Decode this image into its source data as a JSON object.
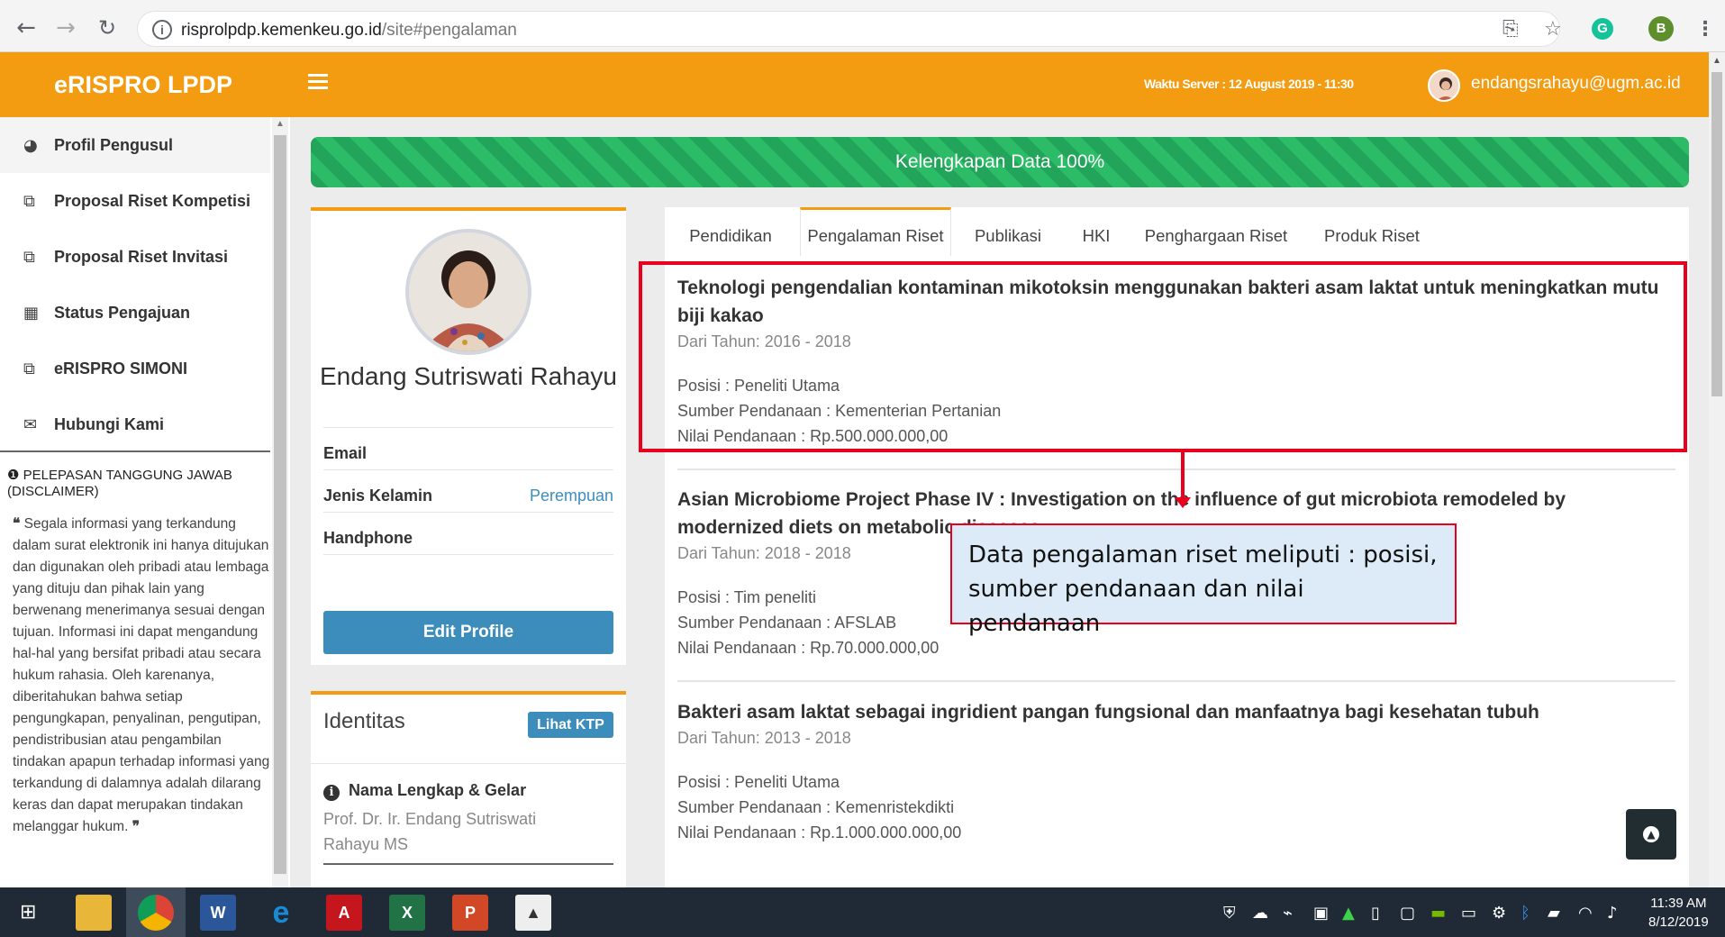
{
  "browser": {
    "url_host": "risprolpdp.kemenkeu.go.id",
    "url_path": "/site#pengalaman",
    "profile_initial": "B",
    "ext_initial": "G"
  },
  "header": {
    "brand": "eRISPRO LPDP",
    "server_time": "Waktu Server : 12 August 2019 - 11:30",
    "user_email": "endangsrahayu@ugm.ac.id"
  },
  "sidebar": {
    "items": [
      {
        "label": "Profil Pengusul",
        "icon": "dashboard-icon"
      },
      {
        "label": "Proposal Riset Kompetisi",
        "icon": "copy-icon"
      },
      {
        "label": "Proposal Riset Invitasi",
        "icon": "copy-icon"
      },
      {
        "label": "Status Pengajuan",
        "icon": "grid-icon"
      },
      {
        "label": "eRISPRO SIMONI",
        "icon": "copy-icon"
      },
      {
        "label": "Hubungi Kami",
        "icon": "envelope-icon"
      }
    ],
    "disclaimer_title": "PELEPASAN TANGGUNG JAWAB (DISCLAIMER)",
    "disclaimer_text": "Segala informasi yang terkandung dalam surat elektronik ini hanya ditujukan dan digunakan oleh pribadi atau lembaga yang dituju dan pihak lain yang berwenang menerimanya sesuai dengan tujuan. Informasi ini dapat mengandung hal-hal yang bersifat pribadi atau secara hukum rahasia. Oleh karenanya, diberitahukan bahwa setiap pengungkapan, penyalinan, pengutipan, pendistribusian atau pengambilan tindakan apapun terhadap informasi yang terkandung di dalamnya adalah dilarang keras dan dapat merupakan tindakan melanggar hukum."
  },
  "progress": {
    "label": "Kelengkapan Data 100%",
    "value_percent": 100
  },
  "profile": {
    "name": "Endang Sutriswati Rahayu",
    "email_label": "Email",
    "email_value": "",
    "gender_label": "Jenis Kelamin",
    "gender_value": "Perempuan",
    "phone_label": "Handphone",
    "phone_value": "",
    "edit_button": "Edit Profile"
  },
  "identity": {
    "title": "Identitas",
    "ktp_button": "Lihat KTP",
    "name_label": "Nama Lengkap & Gelar",
    "name_value": "Prof. Dr. Ir. Endang Sutriswati Rahayu MS"
  },
  "tabs": [
    "Pendidikan",
    "Pengalaman Riset",
    "Publikasi",
    "HKI",
    "Penghargaan Riset",
    "Produk Riset"
  ],
  "active_tab": "Pengalaman Riset",
  "research": [
    {
      "title": "Teknologi pengendalian kontaminan mikotoksin menggunakan bakteri asam laktat untuk meningkatkan mutu biji kakao",
      "years": "Dari Tahun: 2016 - 2018",
      "position": "Posisi : Peneliti Utama",
      "funding_source": "Sumber Pendanaan : Kementerian Pertanian",
      "funding_value": "Nilai Pendanaan : Rp.500.000.000,00"
    },
    {
      "title": "Asian Microbiome Project Phase IV : Investigation on the influence of gut microbiota remodeled by modernized diets on metabolic diseases",
      "years": "Dari Tahun: 2018 - 2018",
      "position": "Posisi : Tim peneliti",
      "funding_source": "Sumber Pendanaan : AFSLAB",
      "funding_value": "Nilai Pendanaan : Rp.70.000.000,00"
    },
    {
      "title": "Bakteri asam laktat sebagai ingridient pangan fungsional dan manfaatnya bagi kesehatan tubuh",
      "years": "Dari Tahun: 2013 - 2018",
      "position": "Posisi : Peneliti Utama",
      "funding_source": "Sumber Pendanaan : Kemenristekdikti",
      "funding_value": "Nilai Pendanaan : Rp.1.000.000.000,00"
    }
  ],
  "callout": {
    "text": "Data pengalaman riset meliputi : posisi, sumber pendanaan dan nilai pendanaan"
  },
  "taskbar": {
    "time": "11:39 AM",
    "date": "8/12/2019"
  },
  "colors": {
    "header_orange": "#f39c12",
    "primary_blue": "#3c8dbc",
    "progress_green": "#22a55a",
    "highlight_red": "#e8001c"
  }
}
